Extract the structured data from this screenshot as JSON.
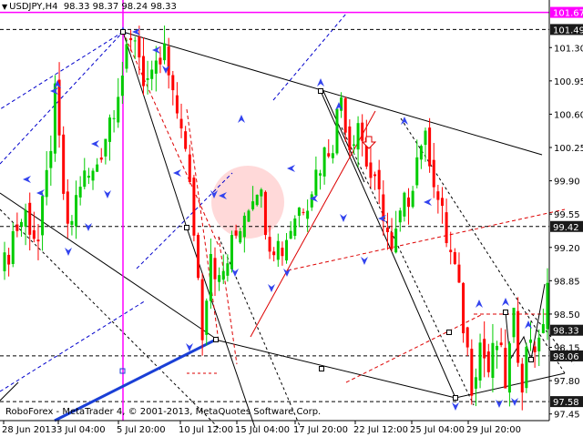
{
  "header": {
    "symbol": "USDJPY,H4",
    "ohlc": "98.33 98.37 98.24 98.33",
    "collapse_glyph": "▼"
  },
  "copyright": "RoboForex - MetaTrader 4, © 2001-2013, MetaQuotes Software Corp.",
  "colors": {
    "bull": "#00cc00",
    "bear": "#ff0000",
    "channel": "#000000",
    "fib_red": "#dd0000",
    "blue_dash": "#0000cc",
    "thick_blue": "#1a3fd6",
    "magenta": "#ff00ff",
    "pink_zone": "#ffd0d0"
  },
  "chart_data": {
    "type": "candlestick",
    "ylim": [
      97.38,
      101.8
    ],
    "y_ticks": [
      "101.30",
      "100.95",
      "100.60",
      "100.25",
      "99.90",
      "99.55",
      "99.20",
      "98.85",
      "98.50",
      "98.15",
      "97.80",
      "97.45"
    ],
    "x_ticks": [
      "28 Jun 2013",
      "3 Jul 04:00",
      "5 Jul 20:00",
      "10 Jul 12:00",
      "15 Jul 04:00",
      "17 Jul 20:00",
      "22 Jul 12:00",
      "25 Jul 04:00",
      "29 Jul 20:00"
    ],
    "price_tags": [
      {
        "label": "101.67",
        "value": 101.67,
        "color": "#ff00ff",
        "text_color": "#ffffff",
        "line": "solid"
      },
      {
        "label": "101.49",
        "value": 101.49,
        "color": "#1a1a1a",
        "text_color": "#ffffff",
        "line": "dashed"
      },
      {
        "label": "99.42",
        "value": 99.42,
        "color": "#1a1a1a",
        "text_color": "#ffffff",
        "line": "dashed"
      },
      {
        "label": "98.33",
        "value": 98.33,
        "color": "#1a1a1a",
        "text_color": "#ffffff",
        "line": "none"
      },
      {
        "label": "98.06",
        "value": 98.06,
        "color": "#1a1a1a",
        "text_color": "#ffffff",
        "line": "dashed"
      },
      {
        "label": "97.58",
        "value": 97.58,
        "color": "#1a1a1a",
        "text_color": "#ffffff",
        "line": "dashed"
      }
    ],
    "vertical_marker_value": "5 Jul 20:00",
    "price_path": [
      {
        "i": 0,
        "p": 99.0
      },
      {
        "i": 2,
        "p": 99.35
      },
      {
        "i": 5,
        "p": 99.55
      },
      {
        "i": 8,
        "p": 99.25
      },
      {
        "i": 10,
        "p": 99.9
      },
      {
        "i": 12,
        "p": 100.75
      },
      {
        "i": 15,
        "p": 99.3
      },
      {
        "i": 18,
        "p": 99.9
      },
      {
        "i": 21,
        "p": 99.95
      },
      {
        "i": 24,
        "p": 100.4
      },
      {
        "i": 27,
        "p": 100.9
      },
      {
        "i": 30,
        "p": 101.3
      },
      {
        "i": 31,
        "p": 101.45
      },
      {
        "i": 33,
        "p": 101.0
      },
      {
        "i": 35,
        "p": 100.9
      },
      {
        "i": 38,
        "p": 101.25
      },
      {
        "i": 40,
        "p": 100.7
      },
      {
        "i": 42,
        "p": 100.55
      },
      {
        "i": 45,
        "p": 99.4
      },
      {
        "i": 47,
        "p": 98.35
      },
      {
        "i": 49,
        "p": 99.2
      },
      {
        "i": 51,
        "p": 98.8
      },
      {
        "i": 54,
        "p": 99.2
      },
      {
        "i": 57,
        "p": 99.6
      },
      {
        "i": 60,
        "p": 99.9
      },
      {
        "i": 63,
        "p": 99.3
      },
      {
        "i": 66,
        "p": 99.2
      },
      {
        "i": 69,
        "p": 99.55
      },
      {
        "i": 72,
        "p": 99.75
      },
      {
        "i": 75,
        "p": 100.1
      },
      {
        "i": 78,
        "p": 100.35
      },
      {
        "i": 80,
        "p": 100.8
      },
      {
        "i": 82,
        "p": 100.3
      },
      {
        "i": 84,
        "p": 100.55
      },
      {
        "i": 86,
        "p": 100.1
      },
      {
        "i": 88,
        "p": 99.8
      },
      {
        "i": 90,
        "p": 99.6
      },
      {
        "i": 92,
        "p": 99.1
      },
      {
        "i": 94,
        "p": 99.5
      },
      {
        "i": 96,
        "p": 99.75
      },
      {
        "i": 99,
        "p": 100.35
      },
      {
        "i": 101,
        "p": 100.2
      },
      {
        "i": 103,
        "p": 99.7
      },
      {
        "i": 105,
        "p": 99.3
      },
      {
        "i": 107,
        "p": 98.95
      },
      {
        "i": 109,
        "p": 98.4
      },
      {
        "i": 111,
        "p": 97.8
      },
      {
        "i": 113,
        "p": 98.2
      },
      {
        "i": 115,
        "p": 97.9
      },
      {
        "i": 117,
        "p": 98.2
      },
      {
        "i": 119,
        "p": 97.8
      },
      {
        "i": 121,
        "p": 98.4
      },
      {
        "i": 123,
        "p": 97.85
      },
      {
        "i": 125,
        "p": 98.3
      },
      {
        "i": 127,
        "p": 98.1
      },
      {
        "i": 129,
        "p": 98.85
      }
    ]
  }
}
